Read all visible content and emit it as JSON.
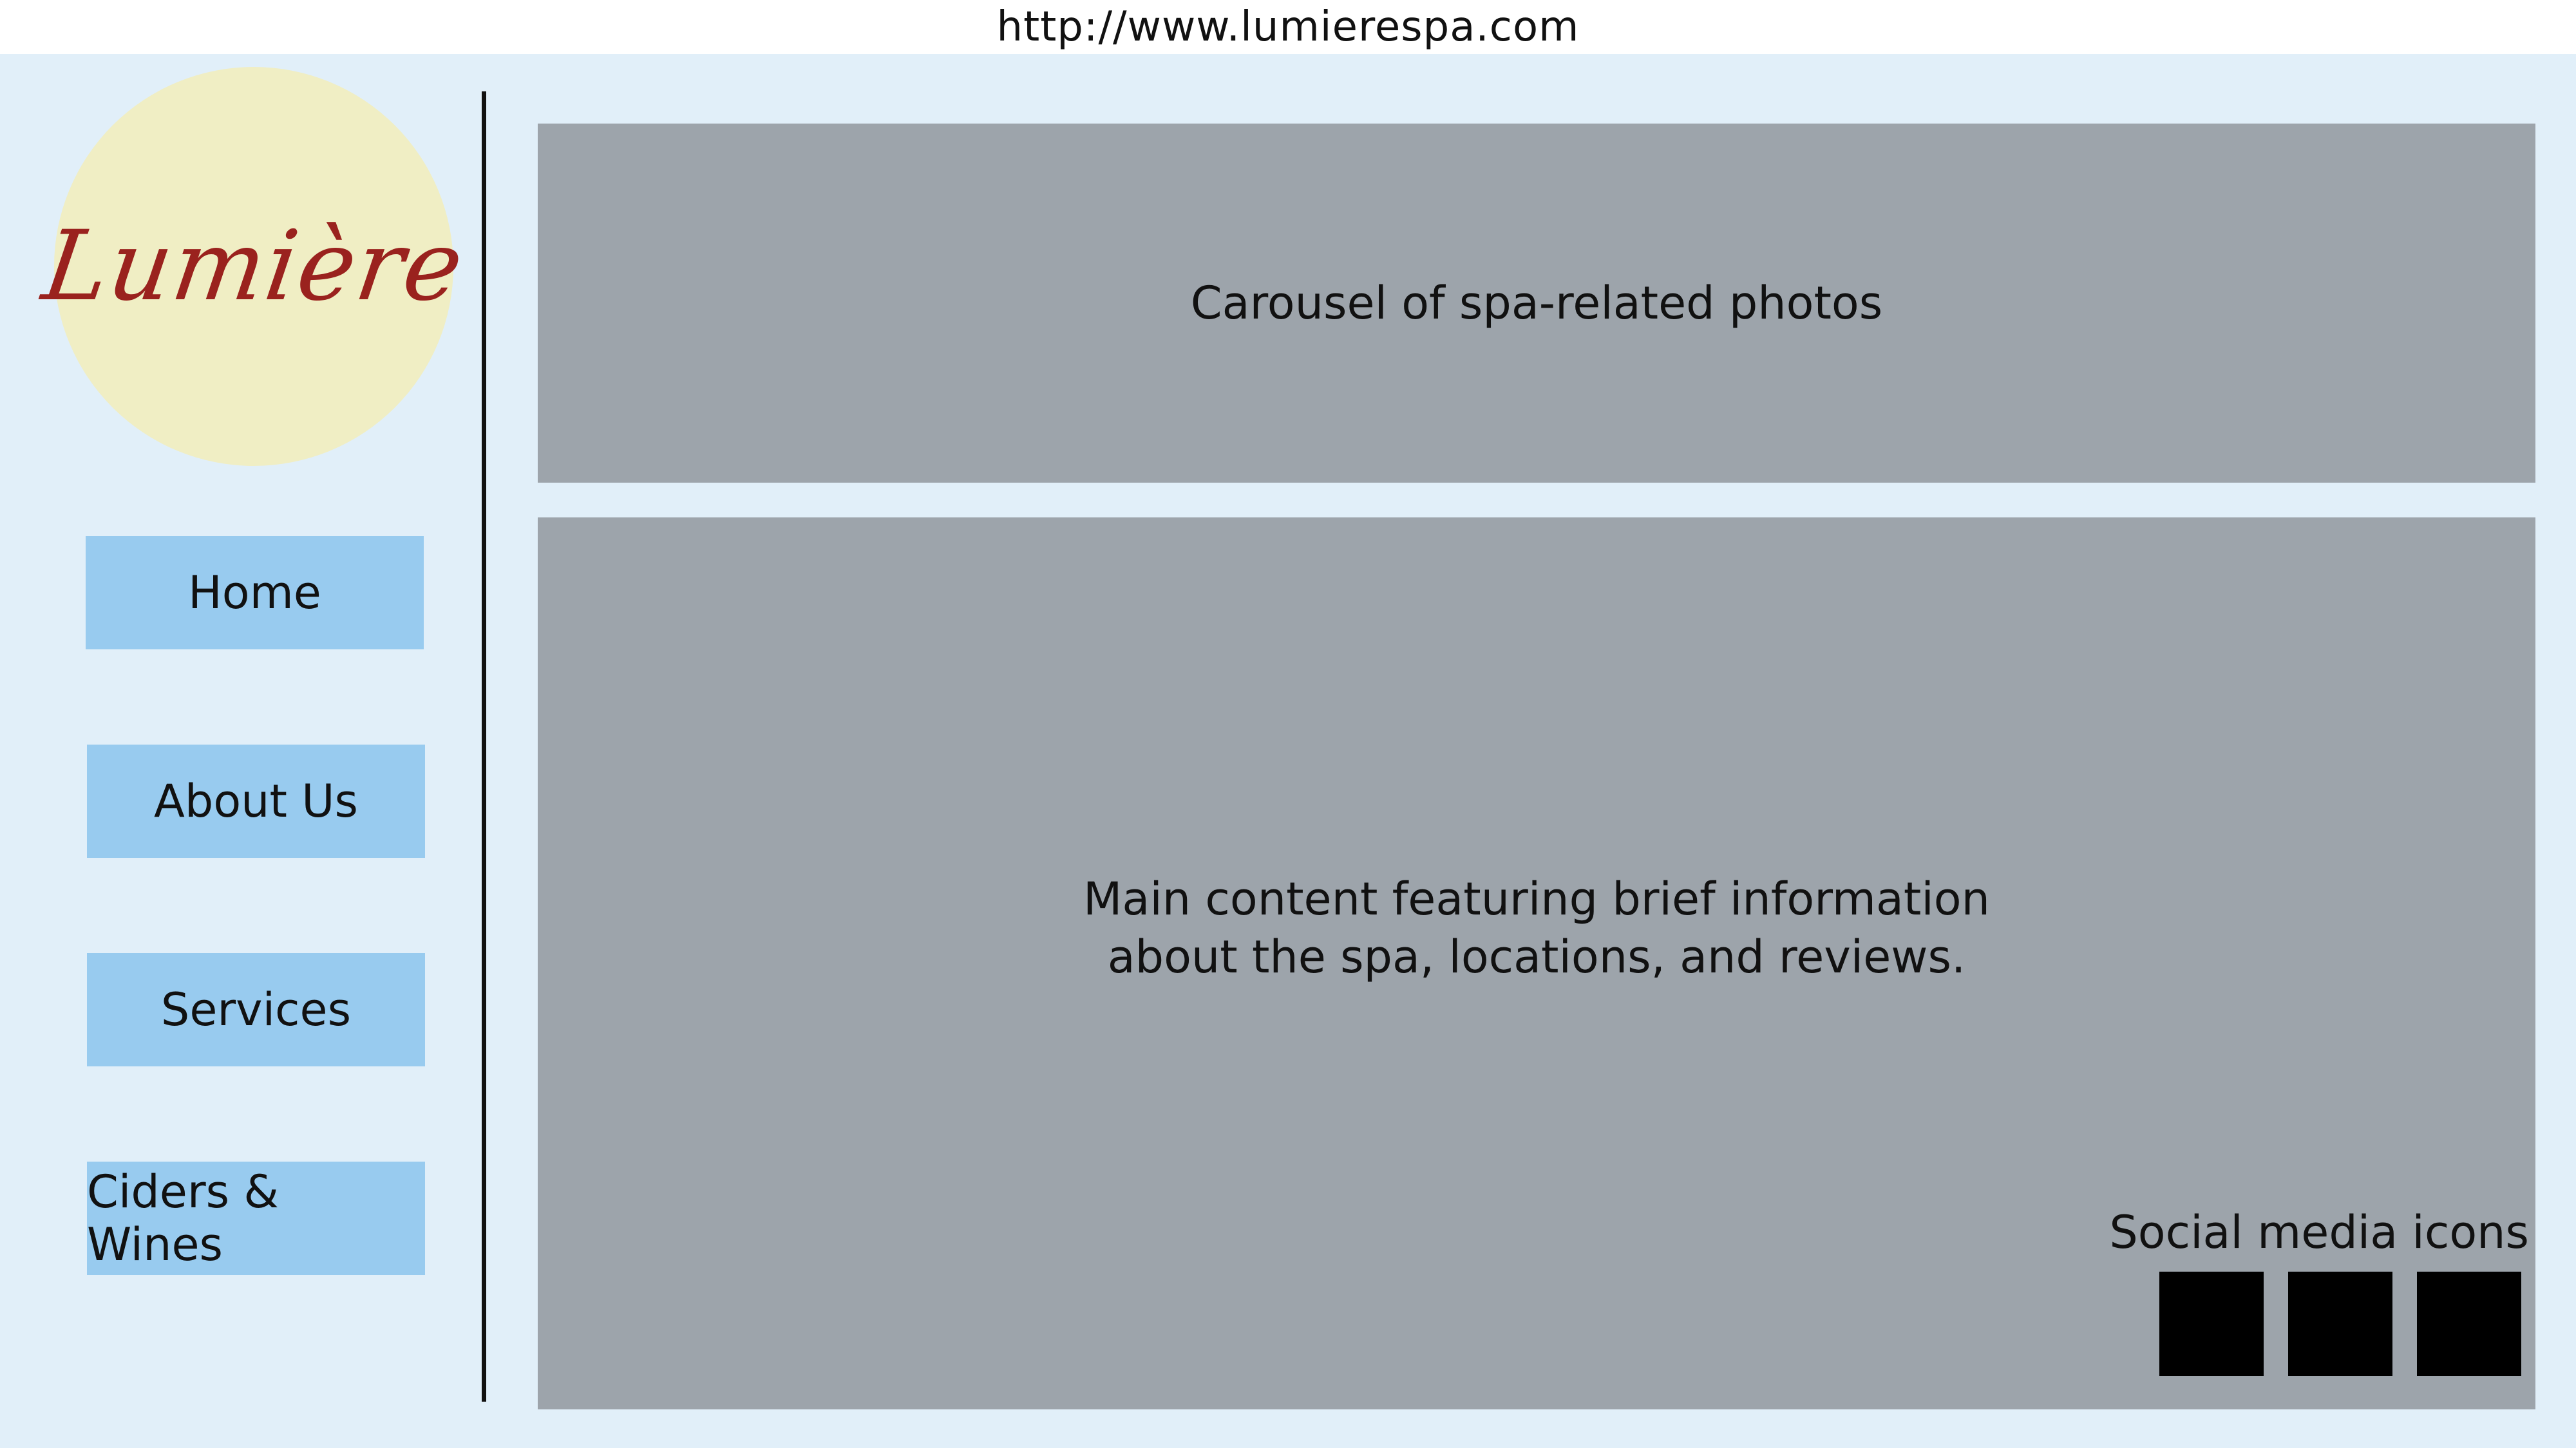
{
  "url_bar": {
    "url": "http://www.lumierespa.com"
  },
  "sidebar": {
    "logo_text": "Lumière",
    "items": [
      {
        "label": "Home"
      },
      {
        "label": "About Us"
      },
      {
        "label": "Services"
      },
      {
        "label": "Ciders & Wines"
      }
    ]
  },
  "carousel": {
    "label": "Carousel of spa-related photos"
  },
  "main": {
    "line1": "Main content featuring brief information",
    "line2": "about the spa, locations, and reviews.",
    "social_label": "Social media icons",
    "social_icons": [
      "social-icon-1",
      "social-icon-2",
      "social-icon-3"
    ]
  },
  "colors": {
    "background": "#e1eff9",
    "logo_circle": "#f0eec4",
    "logo_text": "#9a221e",
    "nav_button": "#98cbef",
    "content_panel": "#9da4ab",
    "social_icon": "#000000"
  }
}
